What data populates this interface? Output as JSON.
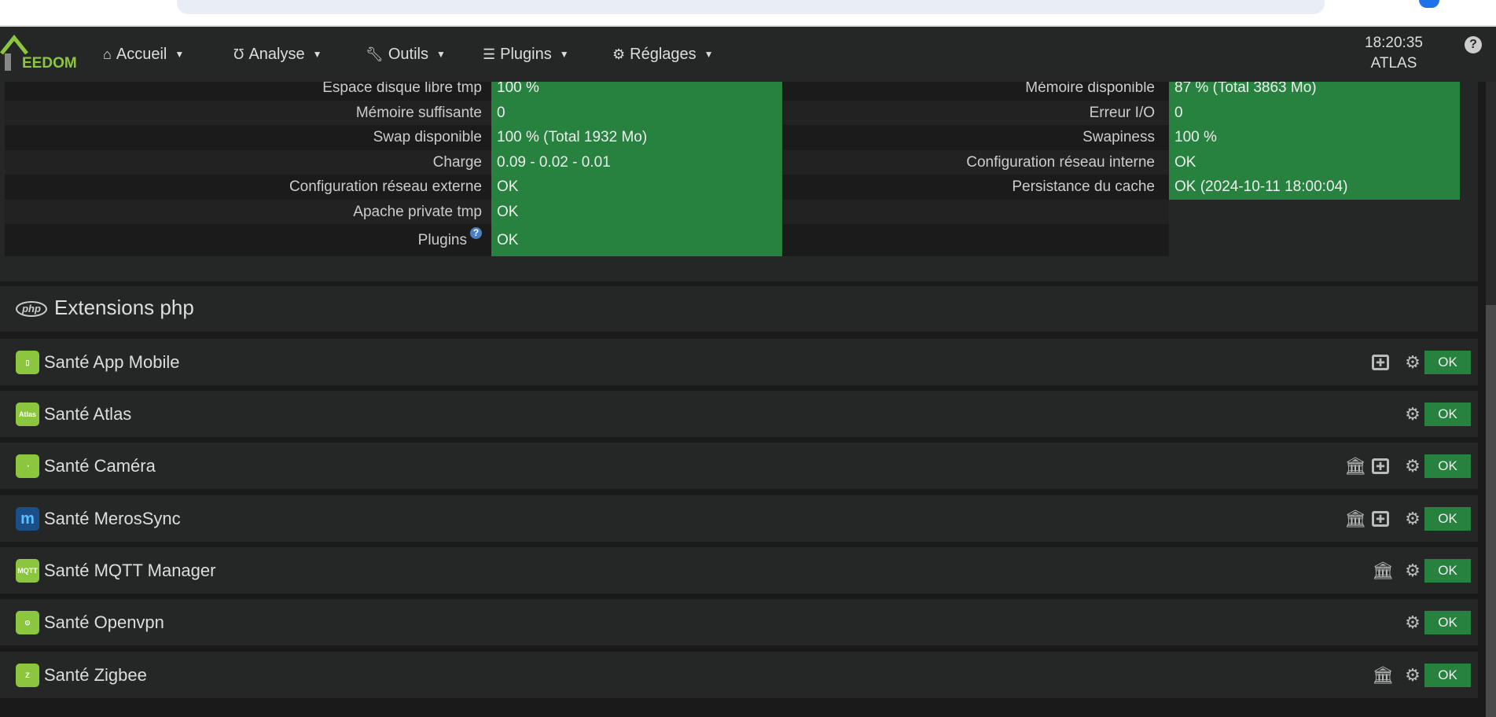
{
  "nav": {
    "brand": "EEDOM",
    "menu": [
      {
        "label": "Accueil",
        "icon": "home-icon"
      },
      {
        "label": "Analyse",
        "icon": "stethoscope-icon"
      },
      {
        "label": "Outils",
        "icon": "wrench-icon"
      },
      {
        "label": "Plugins",
        "icon": "tasks-icon"
      },
      {
        "label": "Réglages",
        "icon": "cog-icon"
      }
    ],
    "time": "18:20:35",
    "host": "ATLAS",
    "help": "?"
  },
  "health_left": [
    {
      "label": "Espace disque libre tmp",
      "value": "100 %"
    },
    {
      "label": "Mémoire suffisante",
      "value": "0"
    },
    {
      "label": "Swap disponible",
      "value": "100 % (Total 1932 Mo)"
    },
    {
      "label": "Charge",
      "value": "0.09 - 0.02 - 0.01"
    },
    {
      "label": "Configuration réseau externe",
      "value": "OK"
    },
    {
      "label": "Apache private tmp",
      "value": "OK"
    },
    {
      "label": "Plugins",
      "value": "OK"
    }
  ],
  "health_right": [
    {
      "label": "Mémoire disponible",
      "value": "87 % (Total 3863 Mo)"
    },
    {
      "label": "Erreur I/O",
      "value": "0"
    },
    {
      "label": "Swapiness",
      "value": "100 %"
    },
    {
      "label": "Configuration réseau interne",
      "value": "OK"
    },
    {
      "label": "Persistance du cache",
      "value": "OK (2024-10-11 18:00:04)"
    }
  ],
  "extensions": {
    "icon_text": "php",
    "title": "Extensions php"
  },
  "plugins": [
    {
      "name": "Santé App Mobile",
      "icon": "▯",
      "status": "OK",
      "actions": [
        "medkit",
        "gears"
      ]
    },
    {
      "name": "Santé Atlas",
      "icon": "Atlas",
      "status": "OK",
      "actions": [
        "gears"
      ]
    },
    {
      "name": "Santé Caméra",
      "icon": "◔",
      "status": "OK",
      "actions": [
        "bank",
        "medkit",
        "gears"
      ]
    },
    {
      "name": "Santé MerosSync",
      "icon": "m",
      "status": "OK",
      "actions": [
        "bank",
        "medkit",
        "gears"
      ]
    },
    {
      "name": "Santé MQTT Manager",
      "icon": "MQTT",
      "status": "OK",
      "actions": [
        "bank",
        "gears"
      ]
    },
    {
      "name": "Santé Openvpn",
      "icon": "⊙",
      "status": "OK",
      "actions": [
        "gears"
      ]
    },
    {
      "name": "Santé Zigbee",
      "icon": "Z",
      "status": "OK",
      "actions": [
        "bank",
        "gears"
      ]
    }
  ],
  "colors": {
    "ok": "#27823f",
    "brand": "#8cc63f"
  }
}
